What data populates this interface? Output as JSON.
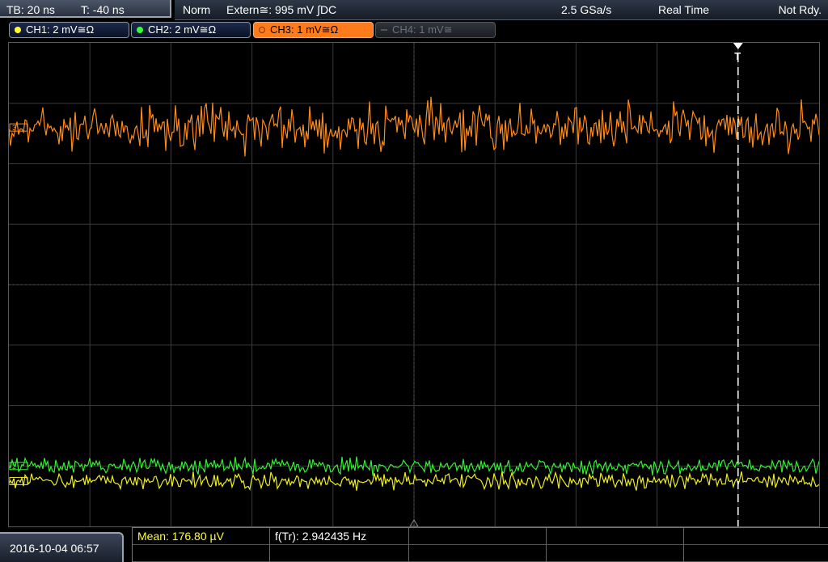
{
  "header": {
    "timebase": "TB: 20 ns",
    "trigger_time": "T: -40 ns",
    "trigger_mode": "Norm",
    "trigger_source": "Extern≅: 995 mV ∫DC",
    "sample_rate": "2.5 GSa/s",
    "acquisition_mode": "Real Time",
    "trigger_status": "Not Rdy."
  },
  "channels": [
    {
      "label": "CH1: 2 mV≅Ω",
      "color": "#ffff33",
      "state": "on"
    },
    {
      "label": "CH2: 2 mV≅Ω",
      "color": "#33ff33",
      "state": "on"
    },
    {
      "label": "CH3: 1 mV≅Ω",
      "color": "#ff8c1a",
      "state": "active"
    },
    {
      "label": "CH4: 1 mV≅",
      "color": "#6c717a",
      "state": "off"
    }
  ],
  "markers": {
    "trigger_marker": "T",
    "ch3_marker": "3",
    "ch2_marker": "2",
    "ch1_marker": "1"
  },
  "traces": {
    "ch3_level_div": 2.6,
    "ch2_level_div": -3.0,
    "ch1_level_div": -3.25,
    "trigger_position_div": 4.0
  },
  "footer": {
    "datetime": "2016-10-04 06:57",
    "measure1": "Mean: 176.80 µV",
    "measure2": "f(Tr): 2.942435 Hz",
    "measure1_color": "#ffff33"
  }
}
